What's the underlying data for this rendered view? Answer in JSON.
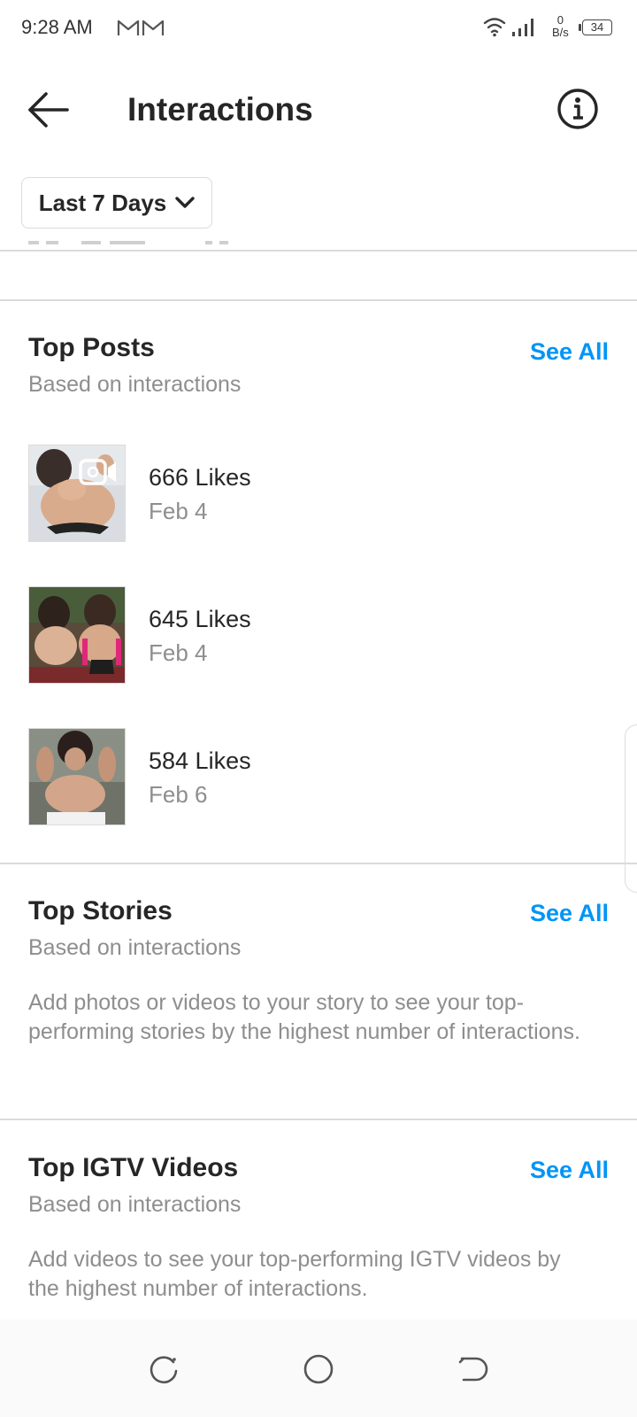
{
  "status_bar": {
    "time": "9:28 AM",
    "notification_icons": [
      "gmail-icon",
      "gmail-icon"
    ],
    "net_speed_value": "0",
    "net_speed_unit": "B/s",
    "battery": "34"
  },
  "header": {
    "title": "Interactions",
    "back_icon": "arrow-left-icon",
    "info_icon": "info-icon"
  },
  "filter": {
    "label": "Last 7 Days",
    "icon": "chevron-down-icon"
  },
  "top_posts": {
    "title": "Top Posts",
    "subtitle": "Based on interactions",
    "see_all": "See All",
    "items": [
      {
        "likes": "666 Likes",
        "date": "Feb 4",
        "badge": "video-icon"
      },
      {
        "likes": "645 Likes",
        "date": "Feb 4"
      },
      {
        "likes": "584 Likes",
        "date": "Feb 6"
      }
    ]
  },
  "top_stories": {
    "title": "Top Stories",
    "subtitle": "Based on interactions",
    "see_all": "See All",
    "empty_text": "Add photos or videos to your story to see your top-performing stories by the highest number of interactions."
  },
  "top_igtv": {
    "title": "Top IGTV Videos",
    "subtitle": "Based on interactions",
    "see_all": "See All",
    "empty_text": "Add videos to see your top-performing IGTV videos by the highest number of interactions."
  },
  "colors": {
    "accent": "#0095f6",
    "text_primary": "#262626",
    "text_secondary": "#8e8e8e",
    "divider": "#dbdbdb"
  }
}
